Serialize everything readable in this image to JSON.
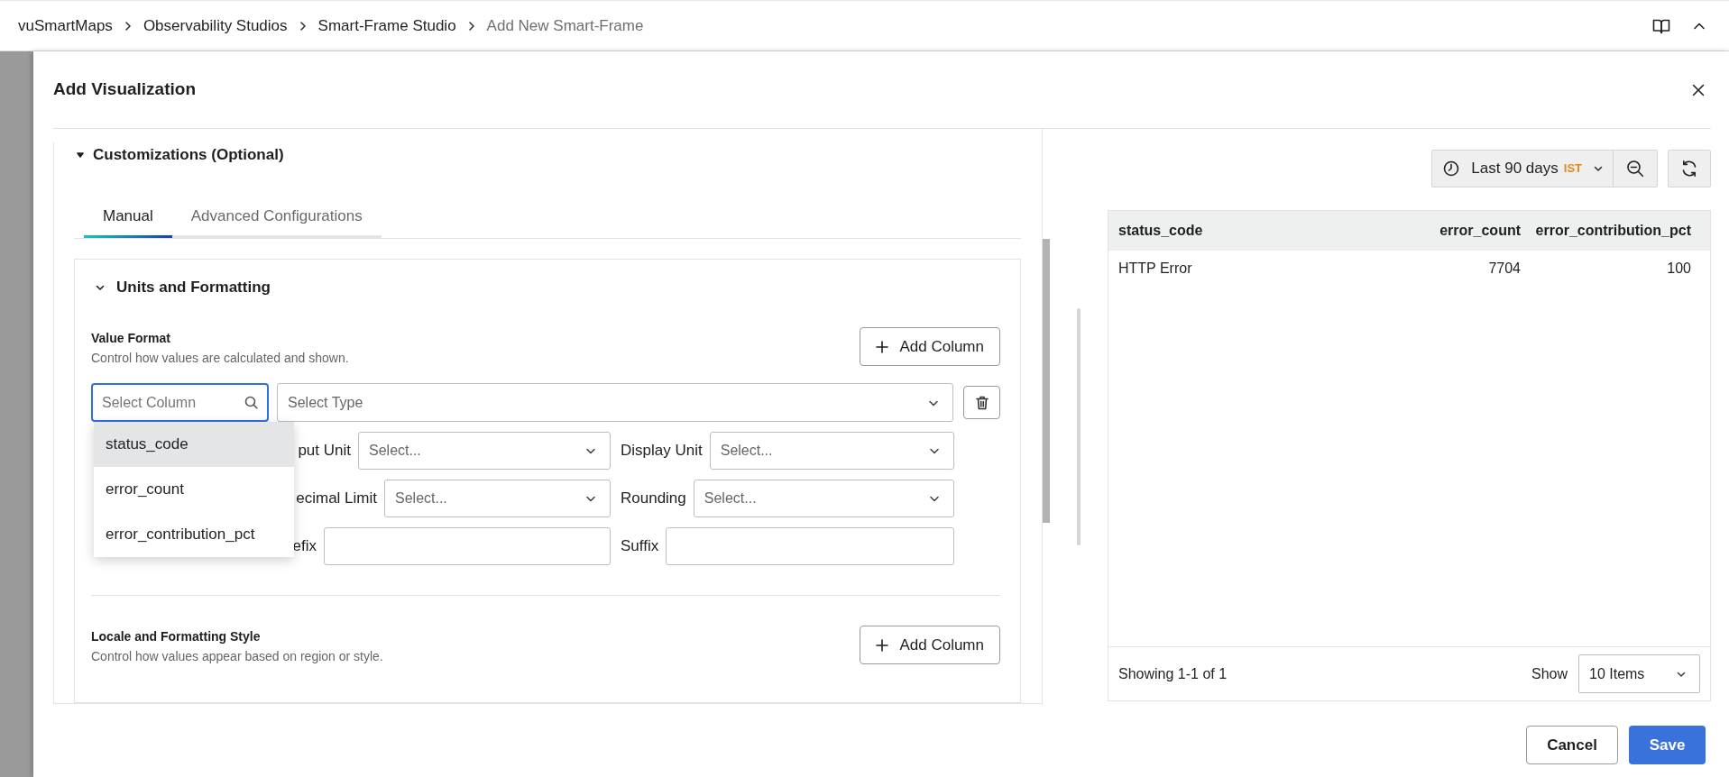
{
  "breadcrumb": [
    {
      "label": "vuSmartMaps",
      "current": false
    },
    {
      "label": "Observability Studios",
      "current": false
    },
    {
      "label": "Smart-Frame Studio",
      "current": false
    },
    {
      "label": "Add New Smart-Frame",
      "current": true
    }
  ],
  "modal": {
    "title": "Add Visualization"
  },
  "section": {
    "title": "Customizations (Optional)",
    "expanded": true
  },
  "tabs": [
    {
      "label": "Manual",
      "selected": true
    },
    {
      "label": "Advanced Configurations",
      "selected": false
    }
  ],
  "units_panel": {
    "title": "Units and Formatting",
    "expanded": true,
    "value_format": {
      "title": "Value Format",
      "description": "Control how values are calculated and shown.",
      "add_button": "Add Column",
      "column_field": {
        "placeholder": "Select Column",
        "focused": true
      },
      "type_field": {
        "placeholder": "Select Type"
      },
      "rows": [
        [
          {
            "kind": "select",
            "label": "put Unit",
            "placeholder": "Select..."
          },
          {
            "kind": "select",
            "label": "Display Unit",
            "placeholder": "Select..."
          }
        ],
        [
          {
            "kind": "select",
            "label": "ecimal Limit",
            "placeholder": "Select..."
          },
          {
            "kind": "select",
            "label": "Rounding",
            "placeholder": "Select..."
          }
        ],
        [
          {
            "kind": "text",
            "label": "efix"
          },
          {
            "kind": "text",
            "label": "Suffix"
          }
        ]
      ],
      "column_options": [
        {
          "label": "status_code",
          "highlighted": true
        },
        {
          "label": "error_count",
          "highlighted": false
        },
        {
          "label": "error_contribution_pct",
          "highlighted": false
        }
      ]
    },
    "locale_style": {
      "title": "Locale and Formatting Style",
      "description": "Control how values appear based on region or style.",
      "add_button": "Add Column"
    }
  },
  "time_range": {
    "label": "Last 90 days",
    "timezone": "IST"
  },
  "table": {
    "columns": [
      {
        "label": "status_code"
      },
      {
        "label": "error_count"
      },
      {
        "label": "error_contribution_pct"
      }
    ],
    "rows": [
      [
        "HTTP Error",
        "7704",
        "100"
      ]
    ],
    "footer": {
      "summary": "Showing 1-1 of 1",
      "show_label": "Show",
      "page_size": "10 Items"
    }
  },
  "actions": {
    "cancel": "Cancel",
    "save": "Save"
  }
}
